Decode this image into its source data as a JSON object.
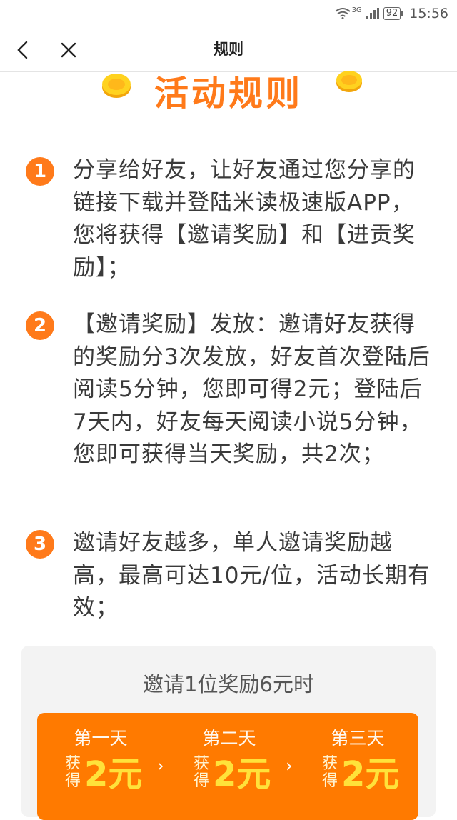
{
  "status_bar": {
    "network": "3G",
    "battery": "92",
    "time": "15:56"
  },
  "nav": {
    "title": "规则"
  },
  "heading": "活动规则",
  "rules": [
    {
      "num": "1",
      "text": "分享给好友，让好友通过您分享的链接下载并登陆米读极速版APP，您将获得【邀请奖励】和【进贡奖励】；"
    },
    {
      "num": "2",
      "text": "【邀请奖励】发放：邀请好友获得的奖励分3次发放，好友首次登陆后阅读5分钟，您即可得2元；登陆后7天内，好友每天阅读小说5分钟，您即可获得当天奖励，共2次；"
    },
    {
      "num": "3",
      "text": "邀请好友越多，单人邀请奖励越高，最高可达10元/位，活动长期有效；"
    }
  ],
  "reward": {
    "title": "邀请1位奖励6元时",
    "days": [
      {
        "label": "第一天",
        "get": "获得",
        "amount": "2元"
      },
      {
        "label": "第二天",
        "get": "获得",
        "amount": "2元"
      },
      {
        "label": "第三天",
        "get": "获得",
        "amount": "2元"
      }
    ],
    "arrow": "›"
  },
  "colors": {
    "accent": "#ff7a1a",
    "strip": "#ff7a00",
    "amount": "#ffe23a"
  }
}
